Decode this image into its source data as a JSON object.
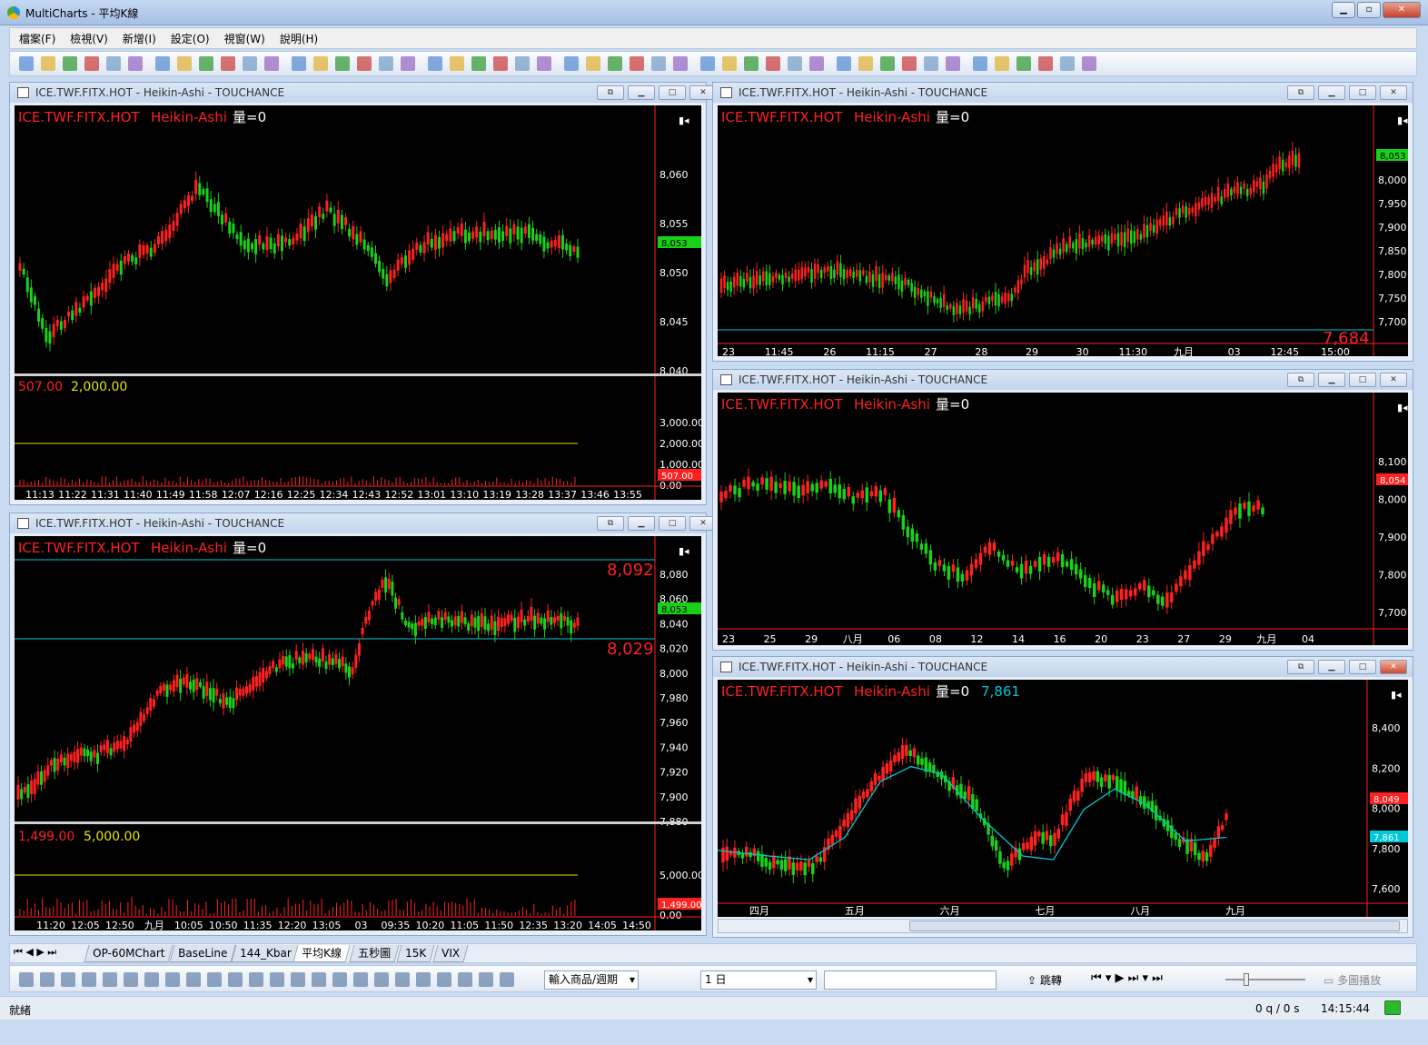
{
  "app": {
    "title": "MultiCharts - 平均K線"
  },
  "menu": [
    "檔案(F)",
    "檢視(V)",
    "新增(I)",
    "設定(O)",
    "視窗(W)",
    "說明(H)"
  ],
  "colors": {
    "up": "#ff2020",
    "down": "#19d219",
    "axis": "#ff2020",
    "cyan": "#00c8d8",
    "yellow": "#e5e500",
    "text": "#ffffff"
  },
  "windows": [
    {
      "id": "w1",
      "title": "ICE.TWF.FITX.HOT - Heikin-Ashi - TOUCHANCE",
      "legend": {
        "symbol": "ICE.TWF.FITX.HOT",
        "type": "Heikin-Ashi",
        "vol": "量=0"
      },
      "yticks": [
        "8,060",
        "8,055",
        "8,050",
        "8,045",
        "8,040"
      ],
      "price_tag": "8,053",
      "sub": {
        "v1": "507.00",
        "v2": "2,000.00",
        "yticks": [
          "3,000.00",
          "2,000.00",
          "1,000.00",
          "0.00"
        ],
        "tag": "507.00"
      },
      "xticks": [
        "11:13",
        "11:22",
        "11:31",
        "11:40",
        "11:49",
        "11:58",
        "12:07",
        "12:16",
        "12:25",
        "12:34",
        "12:43",
        "12:52",
        "13:01",
        "13:10",
        "13:19",
        "13:28",
        "13:37",
        "13:46",
        "13:55"
      ]
    },
    {
      "id": "w2",
      "title": "ICE.TWF.FITX.HOT - Heikin-Ashi - TOUCHANCE",
      "legend": {
        "symbol": "ICE.TWF.FITX.HOT",
        "type": "Heikin-Ashi",
        "vol": "量=0"
      },
      "yticks": [
        "8,000",
        "7,950",
        "7,900",
        "7,850",
        "7,800",
        "7,750",
        "7,700"
      ],
      "price_tag": "8,053",
      "big_label": "7,684",
      "xticks": [
        "23",
        "11:45",
        "26",
        "11:15",
        "27",
        "28",
        "29",
        "30",
        "11:30",
        "九月",
        "03",
        "12:45",
        "15:00"
      ]
    },
    {
      "id": "w3",
      "title": "ICE.TWF.FITX.HOT - Heikin-Ashi - TOUCHANCE",
      "legend": {
        "symbol": "ICE.TWF.FITX.HOT",
        "type": "Heikin-Ashi",
        "vol": "量=0"
      },
      "yticks": [
        "8,080",
        "8,060",
        "8,040",
        "8,020",
        "8,000",
        "7,980",
        "7,960",
        "7,940",
        "7,920",
        "7,900",
        "7,880"
      ],
      "price_tag": "8,053",
      "lines": [
        "8,092",
        "8,029"
      ],
      "sub": {
        "v1": "1,499.00",
        "v2": "5,000.00",
        "yticks": [
          "5,000.00",
          "0.00"
        ],
        "tag": "1,499.00"
      },
      "xticks": [
        "11:20",
        "12:05",
        "12:50",
        "九月",
        "10:05",
        "10:50",
        "11:35",
        "12:20",
        "13:05",
        "03",
        "09:35",
        "10:20",
        "11:05",
        "11:50",
        "12:35",
        "13:20",
        "14:05",
        "14:50"
      ]
    },
    {
      "id": "w4",
      "title": "ICE.TWF.FITX.HOT - Heikin-Ashi - TOUCHANCE",
      "legend": {
        "symbol": "ICE.TWF.FITX.HOT",
        "type": "Heikin-Ashi",
        "vol": "量=0"
      },
      "yticks": [
        "8,100",
        "8,000",
        "7,900",
        "7,800",
        "7,700"
      ],
      "price_tag": "8,054",
      "xticks": [
        "23",
        "25",
        "29",
        "八月",
        "06",
        "08",
        "12",
        "14",
        "16",
        "20",
        "23",
        "27",
        "29",
        "九月",
        "04"
      ]
    },
    {
      "id": "w5",
      "title": "ICE.TWF.FITX.HOT - Heikin-Ashi - TOUCHANCE",
      "legend": {
        "symbol": "ICE.TWF.FITX.HOT",
        "type": "Heikin-Ashi",
        "vol": "量=0",
        "ma": "7,861"
      },
      "yticks": [
        "8,400",
        "8,200",
        "8,000",
        "7,800",
        "7,600"
      ],
      "price_tag": "8,049",
      "ma_tag": "7,861",
      "xticks": [
        "四月",
        "五月",
        "六月",
        "七月",
        "八月",
        "九月"
      ]
    }
  ],
  "tabs": [
    "OP-60MChart",
    "BaseLine",
    "144_Kbar",
    "平均K線",
    "五秒圖",
    "15K",
    "VIX"
  ],
  "active_tab": "平均K線",
  "drawbar": {
    "symbol_select": "輸入商品/週期",
    "period_select": "1 日",
    "jump": "跳轉",
    "multi_play": "多圖播放"
  },
  "status": {
    "left": "就緒",
    "queue": "0 q / 0 s",
    "time": "14:15:44"
  }
}
